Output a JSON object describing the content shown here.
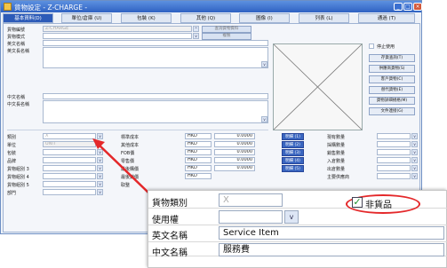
{
  "window": {
    "title": "貨物設定 - Z-CHARGE -",
    "minimize": "_",
    "maximize": "□",
    "close": "×"
  },
  "tabs": [
    "基本資料(D)",
    "單位/倉庫 (U)",
    "包裝 (K)",
    "其他 (Q)",
    "圖像 (I)",
    "列表 (L)",
    "通過 (T)"
  ],
  "form": {
    "item_code_label": "貨物編號",
    "item_code_value": "Z-CHARGE",
    "item_mode_label": "貨物模式",
    "en_name_label": "英文名稱",
    "en_long_name_label": "英文長名稱",
    "cn_name_label": "中文名稱",
    "cn_long_name_label": "中文長名稱",
    "top_btn1": "查詢貨物資料",
    "top_btn2": "複製",
    "category_label": "類別",
    "category_value": "X",
    "unit_label": "單位",
    "unit_value": "UNIT",
    "pack_label": "包裝",
    "brand_label": "品牌",
    "group3_label": "貨物組別 3",
    "group4_label": "貨物組別 4",
    "group5_label": "貨物組別 5",
    "dept_label": "部門"
  },
  "cost_rows": [
    {
      "label": "標準成本",
      "currency": "HKD",
      "value": "0.0000",
      "btn": "明細 (1)",
      "qty_label": "現有數量"
    },
    {
      "label": "其他成本",
      "currency": "HKD",
      "value": "0.0000",
      "btn": "明細 (2)",
      "qty_label": "採購數量"
    },
    {
      "label": "FOB價",
      "currency": "HKD",
      "value": "0.0000",
      "btn": "明細 (3)",
      "qty_label": "銷售數量"
    },
    {
      "label": "零售價",
      "currency": "HKD",
      "value": "0.0000",
      "btn": "明細 (4)",
      "qty_label": "入倉數量"
    },
    {
      "label": "最後購價",
      "currency": "HKD",
      "value": "0.0000",
      "btn": "明細 (5)",
      "qty_label": "出倉數量"
    },
    {
      "label": "最後銷價",
      "currency": "HKD",
      "value": "",
      "btn": "",
      "qty_label": "主要供應商"
    },
    {
      "label": "取整",
      "currency": "",
      "value": "",
      "btn": "",
      "qty_label": ""
    }
  ],
  "right_panel": {
    "discontinued_label": "停止使用",
    "buttons": [
      "存貨查詢(T)",
      "供應商貨物(S)",
      "客戶貨物(C)",
      "替代貨物(E)",
      "貨物詳細規格(M)",
      "文件連接(G)"
    ]
  },
  "zoom": {
    "rows": [
      {
        "label": "貨物類別",
        "value": "X"
      },
      {
        "label": "使用權",
        "value": ""
      },
      {
        "label": "英文名稱",
        "value": "Service Item"
      },
      {
        "label": "中文名稱",
        "value": "服務費"
      }
    ],
    "checkbox_label": "非貨品",
    "checkbox_checked": true
  },
  "colors": {
    "accent": "#2d5bb8",
    "highlight": "#e4282a",
    "check": "#1e8f2a"
  }
}
